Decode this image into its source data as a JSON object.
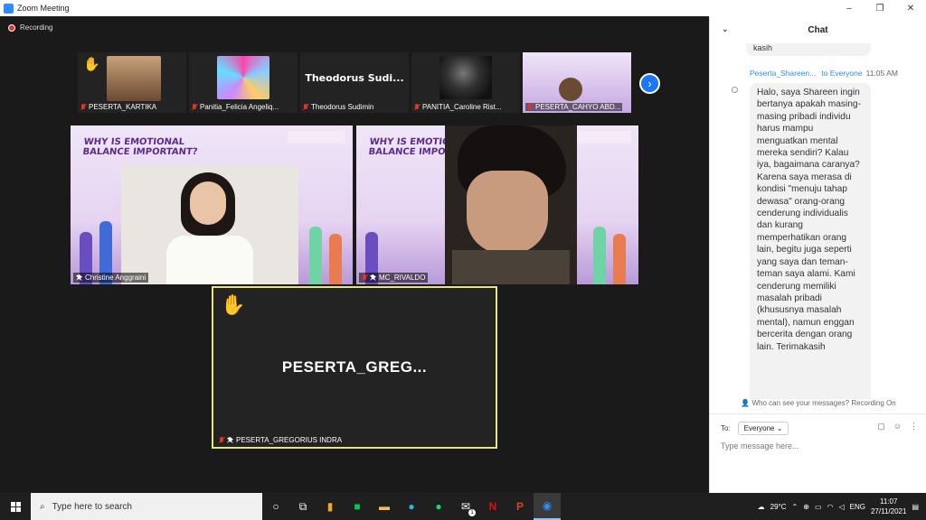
{
  "window": {
    "title": "Zoom Meeting",
    "controls": [
      "–",
      "❐",
      "✕"
    ]
  },
  "recording": {
    "label": "Recording"
  },
  "participants_strip": [
    {
      "name": "PESERTA_KARTIKA",
      "hand_raised": true
    },
    {
      "name": "Panitia_Felicia Angeliq...",
      "hand_raised": false
    },
    {
      "name": "Theodorus Sudimin",
      "display_title": "Theodorus  Sudi...",
      "hand_raised": false
    },
    {
      "name": "PANITIA_Caroline Rist...",
      "hand_raised": false
    },
    {
      "name": "PESERTA_CAHYO ABD...",
      "hand_raised": false
    }
  ],
  "main_tiles": [
    {
      "name": "Christine Anggraini",
      "slide_title": "WHY IS EMOTIONAL BALANCE IMPORTANT?"
    },
    {
      "name": "MC_RIVALDO",
      "slide_title": "WHY IS EMOTIONAL BALANCE IMPORTANT?"
    }
  ],
  "active_tile": {
    "big_name": "PESERTA_GREG...",
    "name": "PESERTA_GREGORIUS INDRA",
    "hand_raised": true
  },
  "chat": {
    "title": "Chat",
    "previous_bubble_tail": "kasih",
    "message": {
      "sender": "Peserta_Shareen...",
      "to_label": "to Everyone",
      "time": "11:05 AM",
      "text": "Halo, saya Shareen ingin bertanya apakah masing-masing pribadi individu harus mampu menguatkan mental mereka sendiri? Kalau iya, bagaimana caranya? Karena saya merasa di kondisi \"menuju tahap dewasa\" orang-orang cenderung individualis dan kurang memperhatikan orang lain, begitu juga seperti yang saya dan teman-teman saya alami. Kami cenderung memiliki masalah pribadi (khususnya masalah mental), namun enggan bercerita dengan orang lain. Terimakasih"
    },
    "visibility_note": "Who can see your messages? Recording On",
    "to_label": "To:",
    "recipient": "Everyone",
    "placeholder": "Type message here..."
  },
  "taskbar": {
    "search_placeholder": "Type here to search",
    "weather": "29°C",
    "time": "11:07",
    "date": "27/11/2021",
    "mail_badge": "1"
  },
  "colors": {
    "accent": "#2d8cff",
    "active_border": "#e6e67a",
    "recording": "#e0332b"
  }
}
